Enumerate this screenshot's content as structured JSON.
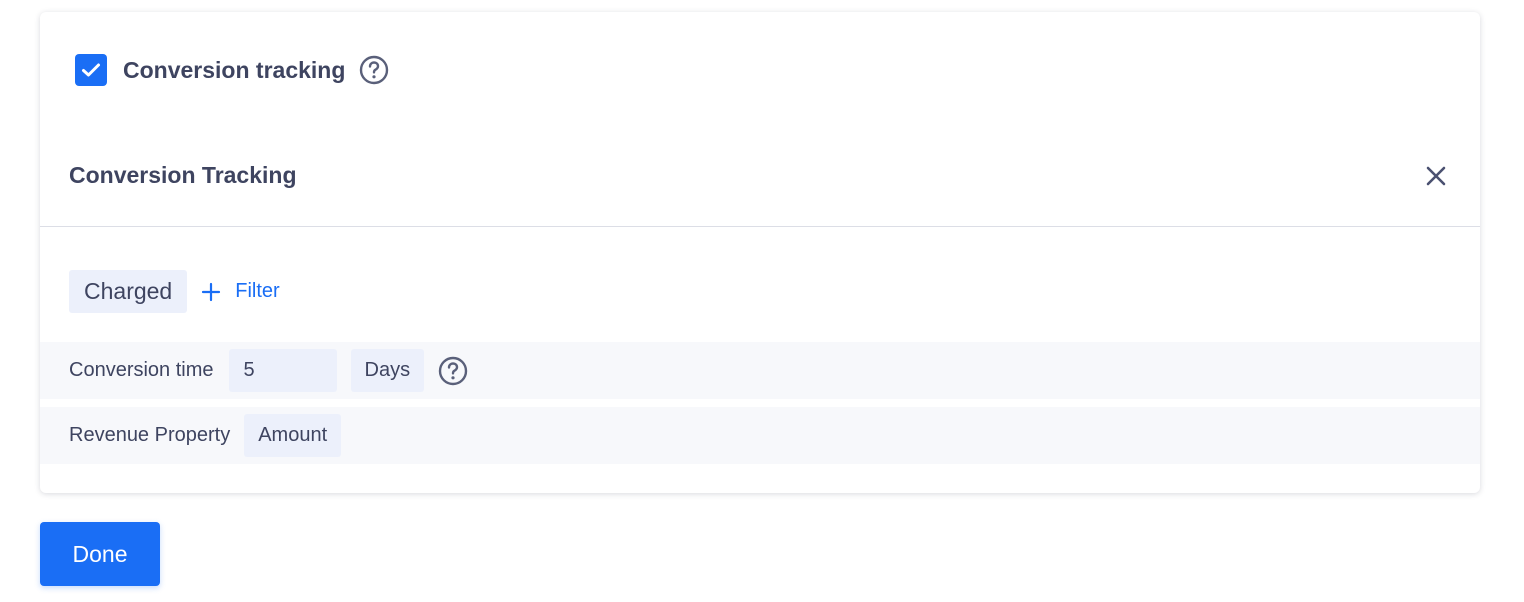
{
  "conversion_toggle": {
    "label": "Conversion tracking",
    "checked": true,
    "help_icon": "question-circle-icon"
  },
  "panel": {
    "title": "Conversion Tracking",
    "close_icon": "close-icon",
    "event": "Charged",
    "filter_label": "Filter",
    "filter_icon": "plus-icon",
    "conversion_time": {
      "label": "Conversion time",
      "value": "5",
      "unit": "Days",
      "help_icon": "question-circle-icon"
    },
    "revenue_property": {
      "label": "Revenue Property",
      "value": "Amount"
    }
  },
  "done_label": "Done",
  "colors": {
    "accent": "#1a6ef5",
    "text": "#3e4460",
    "chip_bg": "#ecf0fb",
    "row_bg": "#f7f8fb"
  }
}
